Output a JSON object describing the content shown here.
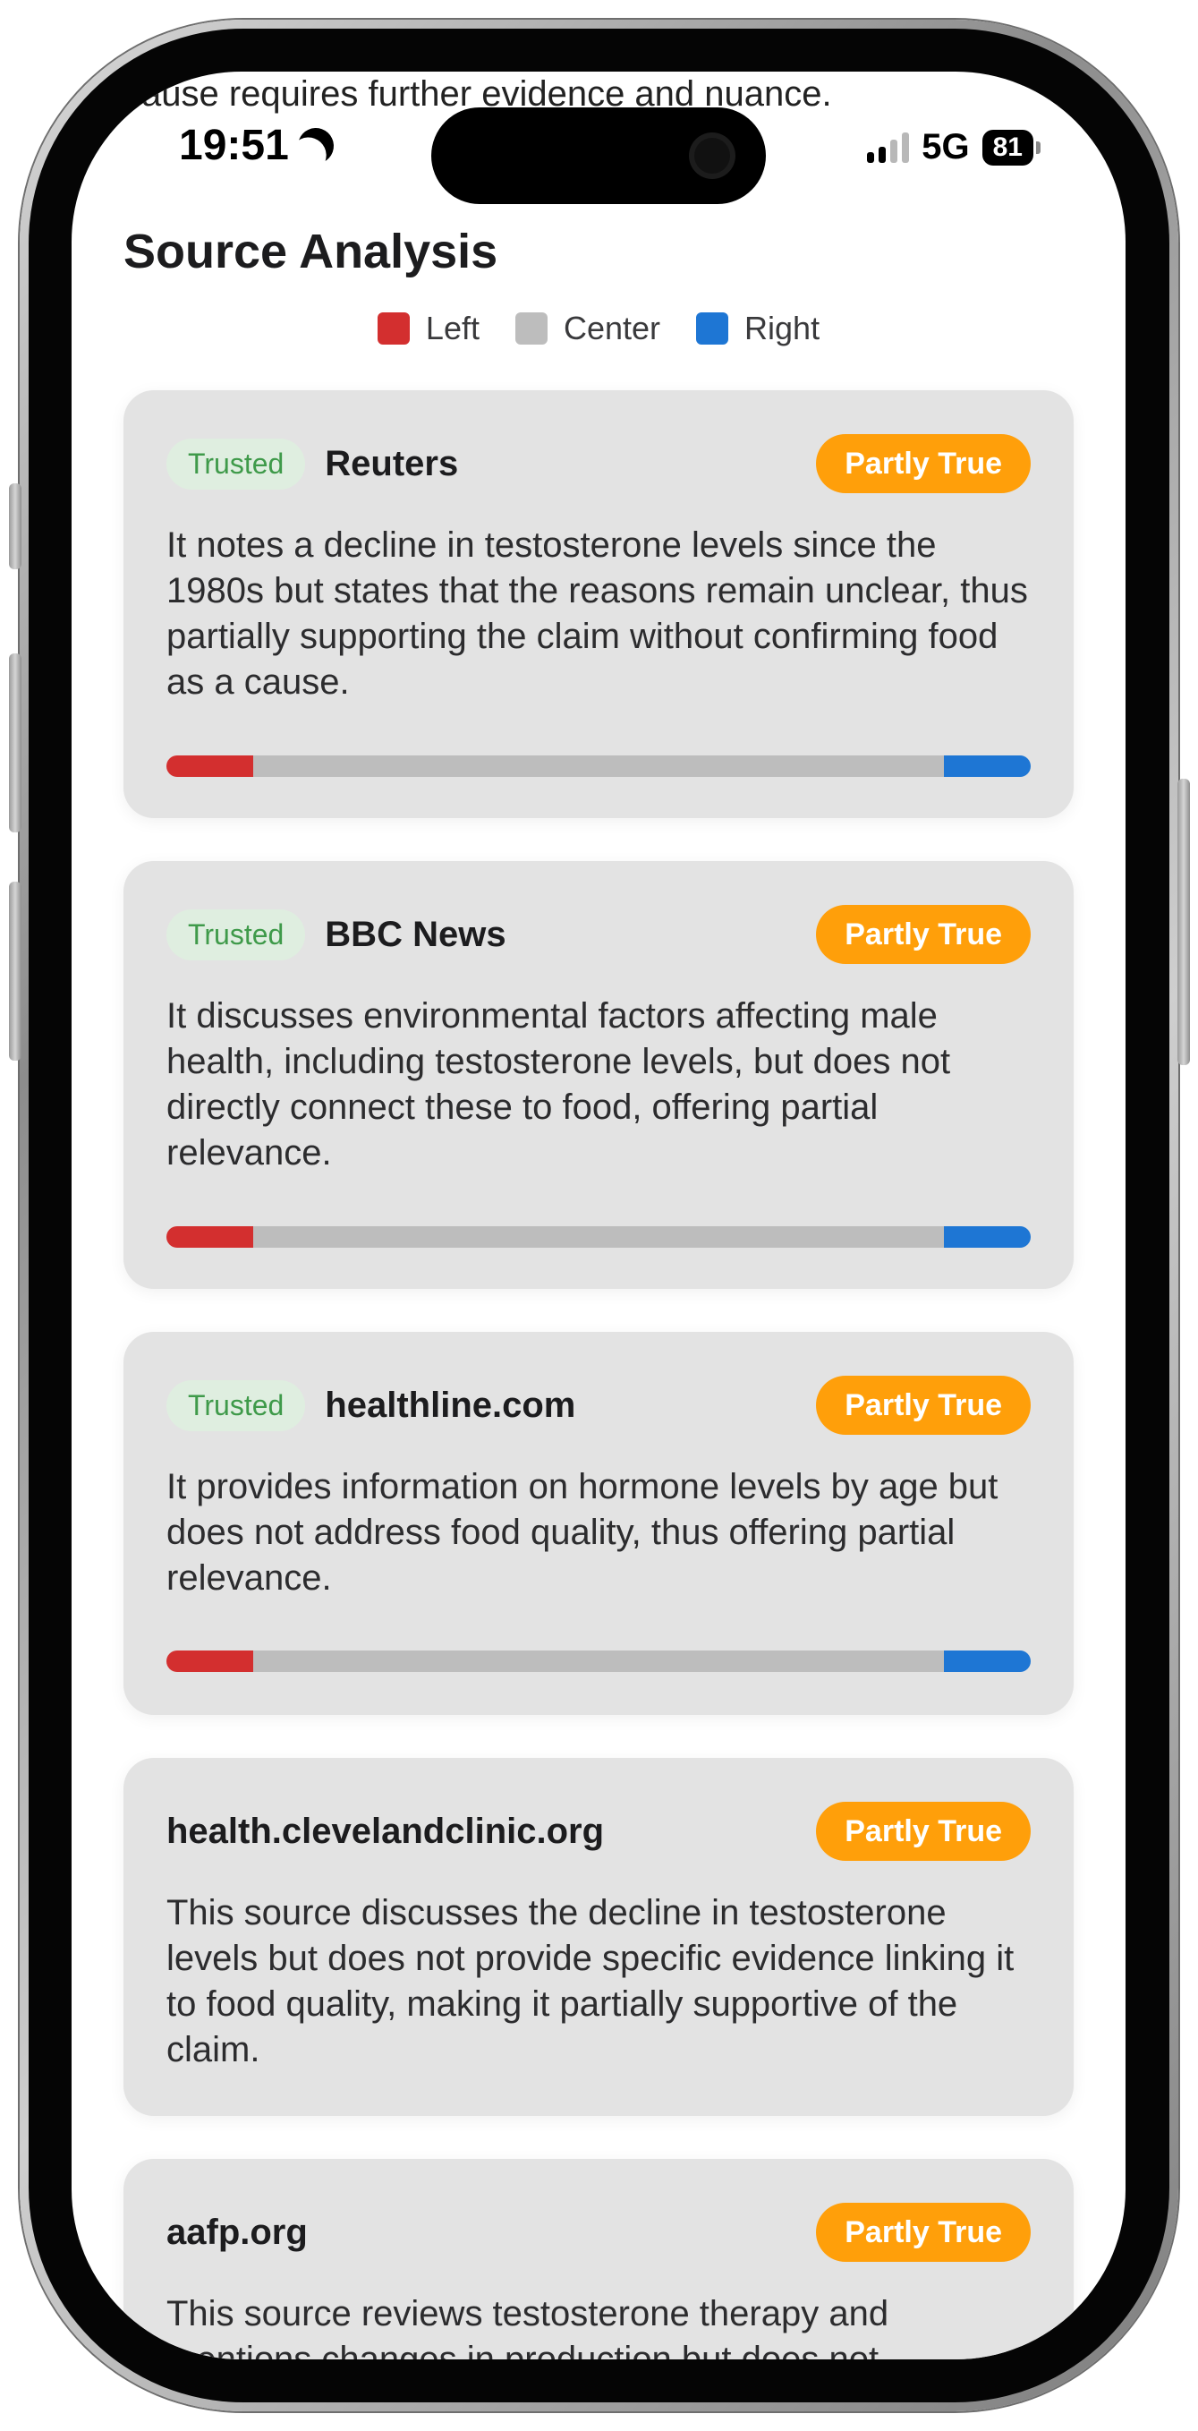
{
  "status_bar": {
    "time": "19:51",
    "network": "5G",
    "battery": "81"
  },
  "previous_text": "...ing testosterone levels, the claim's assertion about the cause requires further evidence and nuance.",
  "section": {
    "title": "Source Analysis"
  },
  "legend": [
    {
      "label": "Left",
      "color": "#d32f2f"
    },
    {
      "label": "Center",
      "color": "#bdbdbd"
    },
    {
      "label": "Right",
      "color": "#1e76d4"
    }
  ],
  "colors": {
    "verdict_partly_true": "#ff9f0a",
    "trusted_bg": "#dfeee0",
    "trusted_text": "#3f9a4a",
    "card_bg": "#e3e3e3"
  },
  "cards": [
    {
      "trusted": "Trusted",
      "name": "Reuters",
      "verdict": "Partly True",
      "text": "It notes a decline in testosterone levels since the 1980s but states that the reasons remain unclear, thus partially supporting the claim without confirming food as a cause.",
      "bias": {
        "left": 0.1,
        "center": 0.8,
        "right": 0.1
      }
    },
    {
      "trusted": "Trusted",
      "name": "BBC News",
      "verdict": "Partly True",
      "text": "It discusses environmental factors affecting male health, including testosterone levels, but does not directly connect these to food, offering partial relevance.",
      "bias": {
        "left": 0.1,
        "center": 0.8,
        "right": 0.1
      }
    },
    {
      "trusted": "Trusted",
      "name": "healthline.com",
      "verdict": "Partly True",
      "text": "It provides information on hormone levels by age but does not address food quality, thus offering partial relevance.",
      "bias": {
        "left": 0.1,
        "center": 0.8,
        "right": 0.1
      }
    },
    {
      "name": "health.clevelandclinic.org",
      "verdict": "Partly True",
      "text": "This source discusses the decline in testosterone levels but does not provide specific evidence linking it to food quality, making it partially supportive of the claim."
    },
    {
      "name": "aafp.org",
      "verdict": "Partly True",
      "text": "This source reviews testosterone therapy and mentions changes in production but does not..."
    }
  ]
}
